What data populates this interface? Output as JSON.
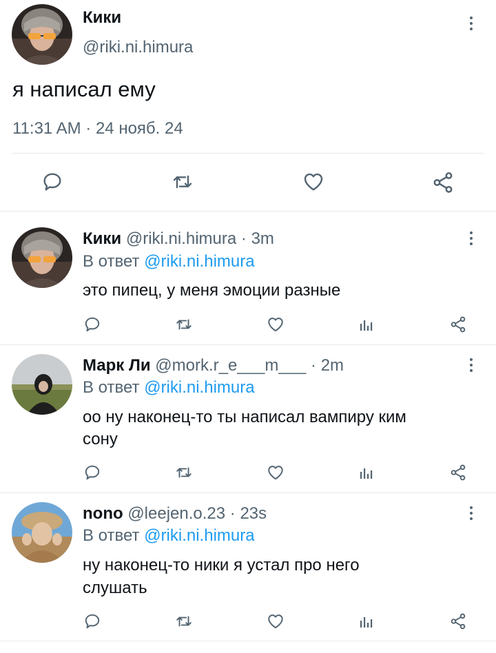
{
  "main_tweet": {
    "author_name": "Кики",
    "handle": "@riki.ni.himura",
    "text": "я написал ему",
    "timestamp": "11:31 AM · 24 нояб. 24",
    "actions": [
      "reply-icon",
      "retweet-icon",
      "like-icon",
      "share-icon"
    ]
  },
  "replies": [
    {
      "author_name": "Кики",
      "meta": "@riki.ni.himura · 3m",
      "reply_prefix": "В ответ",
      "reply_to": "@riki.ni.himura",
      "text_lines": [
        "это пипец, у меня эмоции разные"
      ]
    },
    {
      "author_name": "Марк Ли",
      "meta": "@mork.r_e___m___ · 2m",
      "reply_prefix": "В ответ",
      "reply_to": "@riki.ni.himura",
      "text_lines": [
        "оо ну наконец-то ты написал вампиру ким",
        "сону"
      ]
    },
    {
      "author_name": "nono",
      "meta": "@leejen.o.23 · 23s",
      "reply_prefix": "В ответ",
      "reply_to": "@riki.ni.himura",
      "text_lines": [
        "ну наконец-то ники я устал про него",
        "слушать"
      ]
    }
  ],
  "colors": {
    "text": "#0f1419",
    "muted": "#536471",
    "link": "#1d9bf0",
    "divider": "#e6e9ec"
  }
}
